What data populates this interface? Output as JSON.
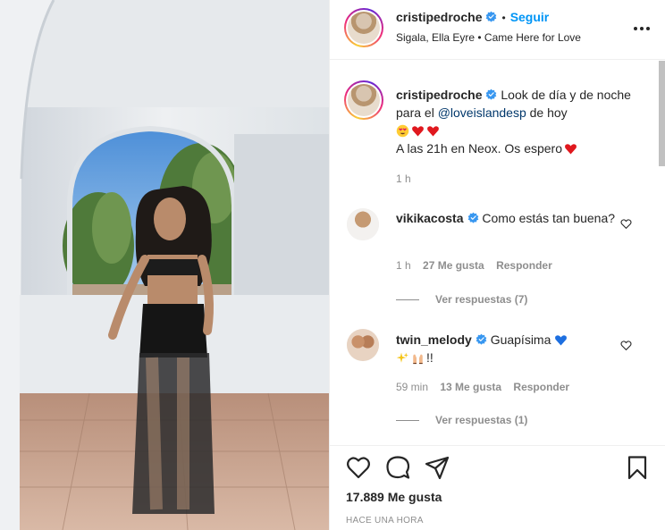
{
  "post": {
    "author": {
      "username": "cristipedroche",
      "verified": true,
      "follow_label": "Seguir",
      "audio": "Sigala, Ella Eyre • Came Here for Love"
    },
    "caption": {
      "username": "cristipedroche",
      "text_part1": "Look de día y de noche para el",
      "mention": "@loveislandesp",
      "text_part2": "de hoy",
      "line2": "A las 21h en Neox. Os espero",
      "time": "1 h"
    },
    "comments": [
      {
        "username": "vikikacosta",
        "text": "Como estás tan buena?",
        "time": "1 h",
        "likes": "27 Me gusta",
        "reply_label": "Responder",
        "view_replies": "Ver respuestas (7)"
      },
      {
        "username": "twin_melody",
        "text": "Guapísima",
        "text_tail": "!!",
        "time": "59 min",
        "likes": "13 Me gusta",
        "reply_label": "Responder",
        "view_replies": "Ver respuestas (1)"
      }
    ],
    "likes": "17.889 Me gusta",
    "timestamp": "HACE UNA HORA",
    "icons": [
      "more-options-icon",
      "verified-badge-icon",
      "heart-icon",
      "comment-icon",
      "share-icon",
      "bookmark-icon",
      "heart-emoji",
      "heart-eyes-emoji",
      "blue-heart-emoji",
      "sparkles-emoji",
      "raised-hands-emoji"
    ],
    "colors": {
      "accent": "#0095f6",
      "verified": "#3897f0",
      "heart": "#ed4956",
      "muted": "#8e8e8e"
    }
  }
}
